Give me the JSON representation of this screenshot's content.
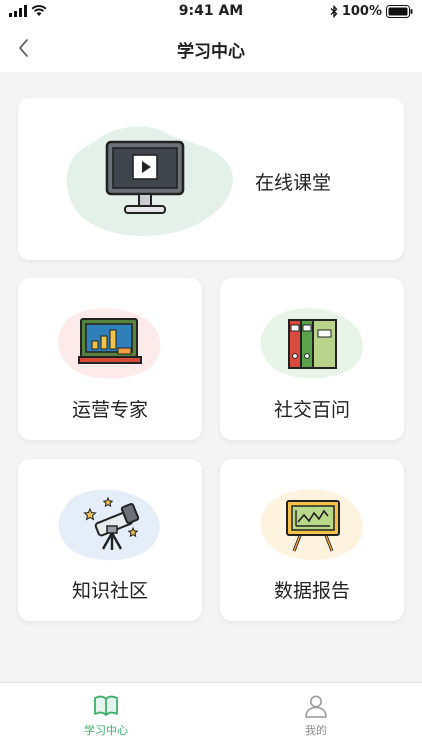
{
  "status_bar": {
    "time": "9:41 AM",
    "battery": "100%",
    "icons": [
      "signal-icon",
      "wifi-icon",
      "bluetooth-icon",
      "battery-icon"
    ]
  },
  "nav": {
    "title": "学习中心",
    "back_icon": "chevron-left-icon"
  },
  "cards": {
    "online_class": {
      "label": "在线课堂",
      "icon": "monitor-play-icon",
      "blob_color": "#e3f1ea"
    },
    "operations_expert": {
      "label": "运营专家",
      "icon": "chalkboard-chart-icon",
      "blob_color": "#fdeaea"
    },
    "social_encyclopedia": {
      "label": "社交百问",
      "icon": "books-icon",
      "blob_color": "#e7f4e7"
    },
    "knowledge_community": {
      "label": "知识社区",
      "icon": "telescope-icon",
      "blob_color": "#e5edf8"
    },
    "data_report": {
      "label": "数据报告",
      "icon": "easel-chart-icon",
      "blob_color": "#fdf3df"
    }
  },
  "tab_bar": {
    "tabs": [
      {
        "label": "学习中心",
        "icon": "open-book-icon",
        "active": true
      },
      {
        "label": "我的",
        "icon": "user-icon",
        "active": false
      }
    ],
    "active_color": "#3db06b",
    "inactive_color": "#8a8a8a"
  }
}
